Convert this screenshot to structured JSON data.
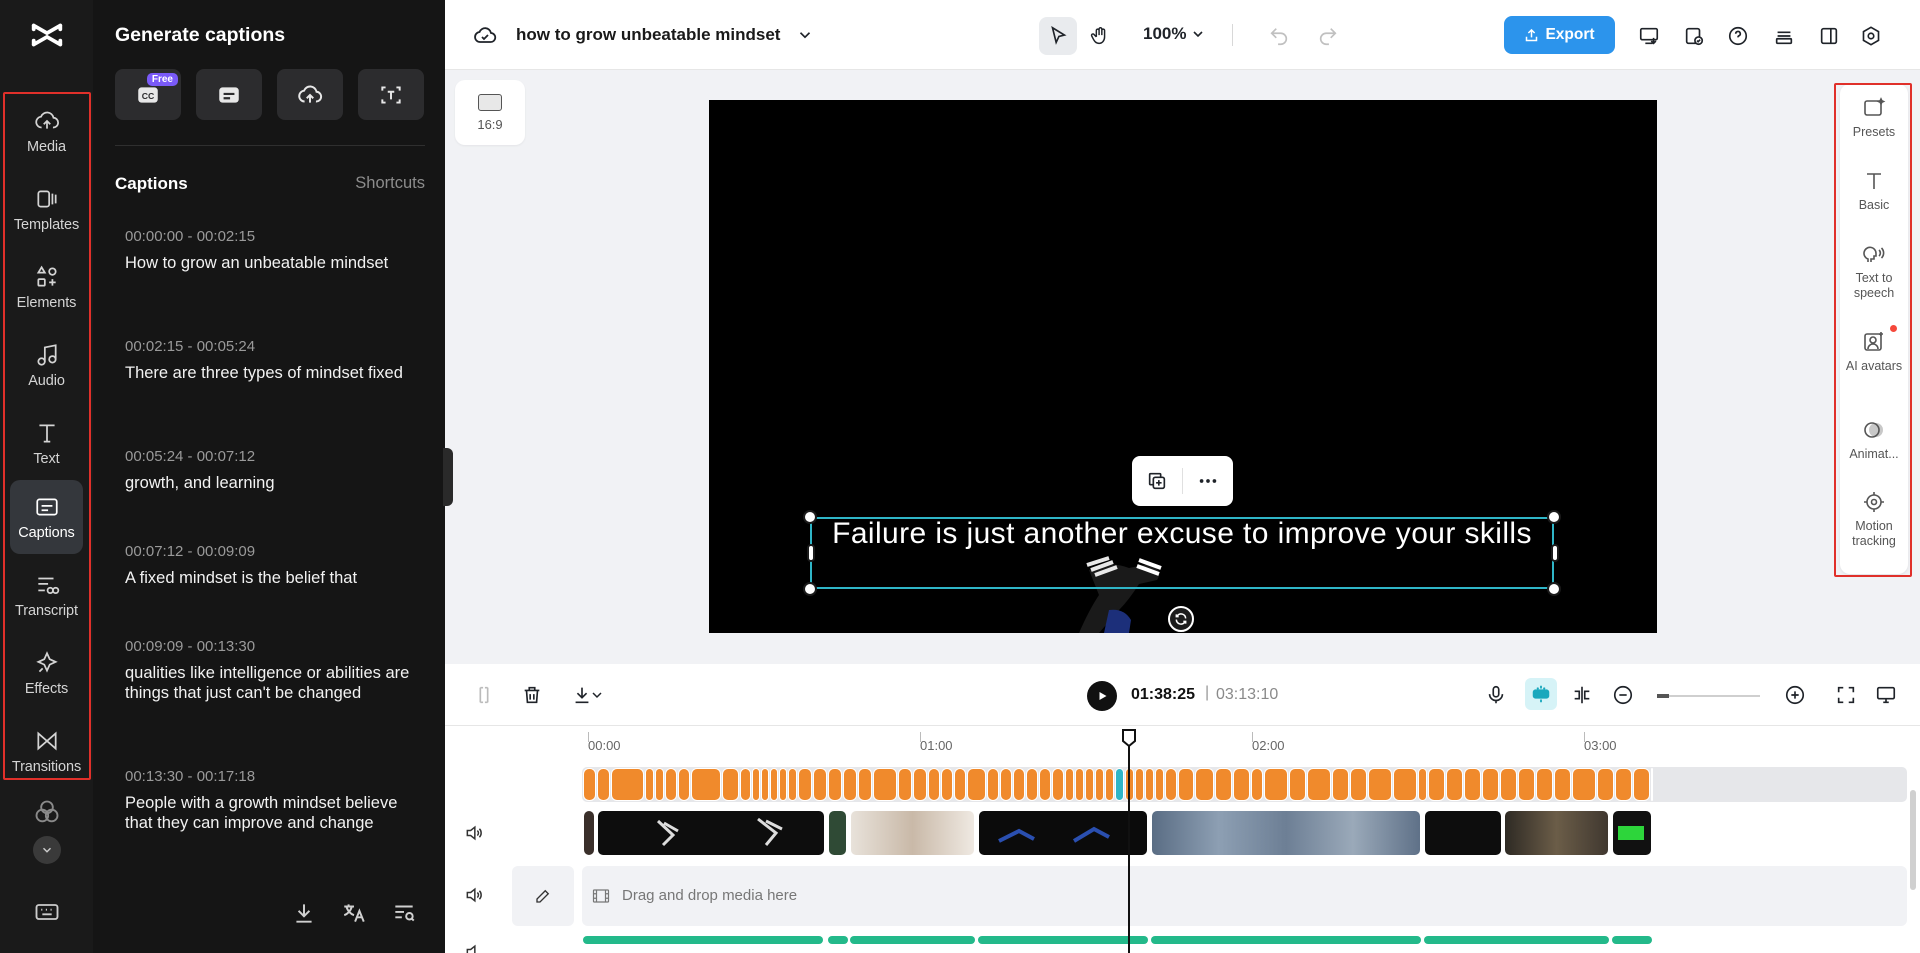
{
  "left_rail": {
    "items": [
      {
        "label": "Media",
        "icon": "cloud-upload-icon"
      },
      {
        "label": "Templates",
        "icon": "templates-icon"
      },
      {
        "label": "Elements",
        "icon": "elements-icon"
      },
      {
        "label": "Audio",
        "icon": "music-note-icon"
      },
      {
        "label": "Text",
        "icon": "text-icon"
      },
      {
        "label": "Captions",
        "icon": "captions-icon",
        "active": true
      },
      {
        "label": "Transcript",
        "icon": "transcript-icon"
      },
      {
        "label": "Effects",
        "icon": "effects-icon"
      },
      {
        "label": "Transitions",
        "icon": "transitions-icon"
      }
    ]
  },
  "panel": {
    "title": "Generate captions",
    "free_badge": "Free",
    "captions_heading": "Captions",
    "shortcuts_label": "Shortcuts",
    "captions": [
      {
        "time": "00:00:00 - 00:02:15",
        "text": "How to grow an unbeatable mindset"
      },
      {
        "time": "00:02:15 - 00:05:24",
        "text": "There are three types of mindset fixed"
      },
      {
        "time": "00:05:24 - 00:07:12",
        "text": "growth, and learning"
      },
      {
        "time": "00:07:12 - 00:09:09",
        "text": "A fixed mindset is the belief that"
      },
      {
        "time": "00:09:09 - 00:13:30",
        "text": "qualities like intelligence or abilities are things that just can't be changed"
      },
      {
        "time": "00:13:30 - 00:17:18",
        "text": "People with a growth mindset believe that they can improve and change"
      }
    ]
  },
  "topbar": {
    "project_title": "how to grow unbeatable mindset",
    "zoom": "100%",
    "export_label": "Export"
  },
  "aspect_ratio": "16:9",
  "canvas": {
    "caption_text": "Failure is just another excuse to improve your skills"
  },
  "right_panel": {
    "items": [
      {
        "label": "Presets",
        "icon": "presets-icon"
      },
      {
        "label": "Basic",
        "icon": "text-basic-icon"
      },
      {
        "label": "Text to speech",
        "icon": "text-to-speech-icon"
      },
      {
        "label": "AI avatars",
        "icon": "ai-avatar-icon"
      },
      {
        "label": "Animat...",
        "icon": "animation-icon"
      },
      {
        "label": "Motion tracking",
        "icon": "motion-tracking-icon"
      }
    ]
  },
  "timeline": {
    "current_time": "01:38:25",
    "separator": "|",
    "total_time": "03:13:10",
    "ruler": [
      "00:00",
      "01:00",
      "02:00",
      "03:00"
    ],
    "drop_text": "Drag and drop media here"
  },
  "colors": {
    "accent": "#2c94ec",
    "caption_clip": "#f08a2c",
    "selection": "#2fb5c7",
    "highlight_outline": "#e0302a"
  }
}
